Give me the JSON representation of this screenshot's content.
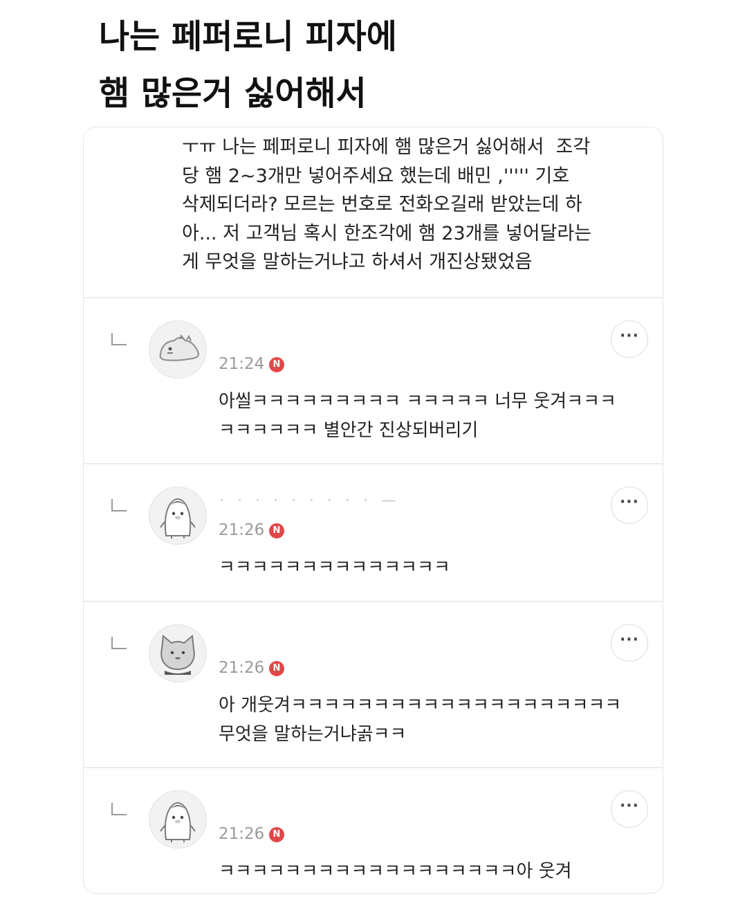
{
  "headline": {
    "line1": "나는 페퍼로니 피자에",
    "line2": "햄 많은거 싫어해서"
  },
  "post": {
    "body": "ㅜㅠ 나는 페퍼로니 피자에 햄 많은거 싫어해서  조각\n당 햄 2~3개만 넣어주세요 했는데 배민 ,''''' 기호\n삭제되더라? 모르는 번호로 전화오길래 받았는데 하\n아... 저 고객님 혹시 한조각에 햄 23개를 넣어달라는\n게 무엇을 말하는거냐고 하셔서 개진상됐었음"
  },
  "comments": [
    {
      "nickname": "",
      "time": "21:24",
      "badge": "N",
      "text": "아씰ㅋㅋㅋㅋㅋㅋㅋㅋㅋ ㅋㅋㅋㅋㅋ 너무 웃겨ㅋㅋㅋ\nㅋㅋㅋㅋㅋㅋ 별안간 진상되버리기",
      "avatar_icon": "dinosaur-avatar-icon",
      "more": "···"
    },
    {
      "nickname": "· · · · · · · · · —",
      "time": "21:26",
      "badge": "N",
      "text": "ㅋㅋㅋㅋㅋㅋㅋㅋㅋㅋㅋㅋㅋㅋ",
      "avatar_icon": "penguin-avatar-icon",
      "more": "···"
    },
    {
      "nickname": "",
      "time": "21:26",
      "badge": "N",
      "text": "아 개웃겨ㅋㅋㅋㅋㅋㅋㅋㅋㅋㅋㅋㅋㅋㅋㅋㅋㅋㅋㅋㅋ\n무엇을 말하는거냐곩ㅋㅋ",
      "avatar_icon": "cat-avatar-icon",
      "more": "···"
    },
    {
      "nickname": "",
      "time": "21:26",
      "badge": "N",
      "text": "ㅋㅋㅋㅋㅋㅋㅋㅋㅋㅋㅋㅋㅋㅋㅋㅋㅋㅋ아 웃겨",
      "avatar_icon": "penguin-avatar-icon",
      "more": "···"
    }
  ]
}
